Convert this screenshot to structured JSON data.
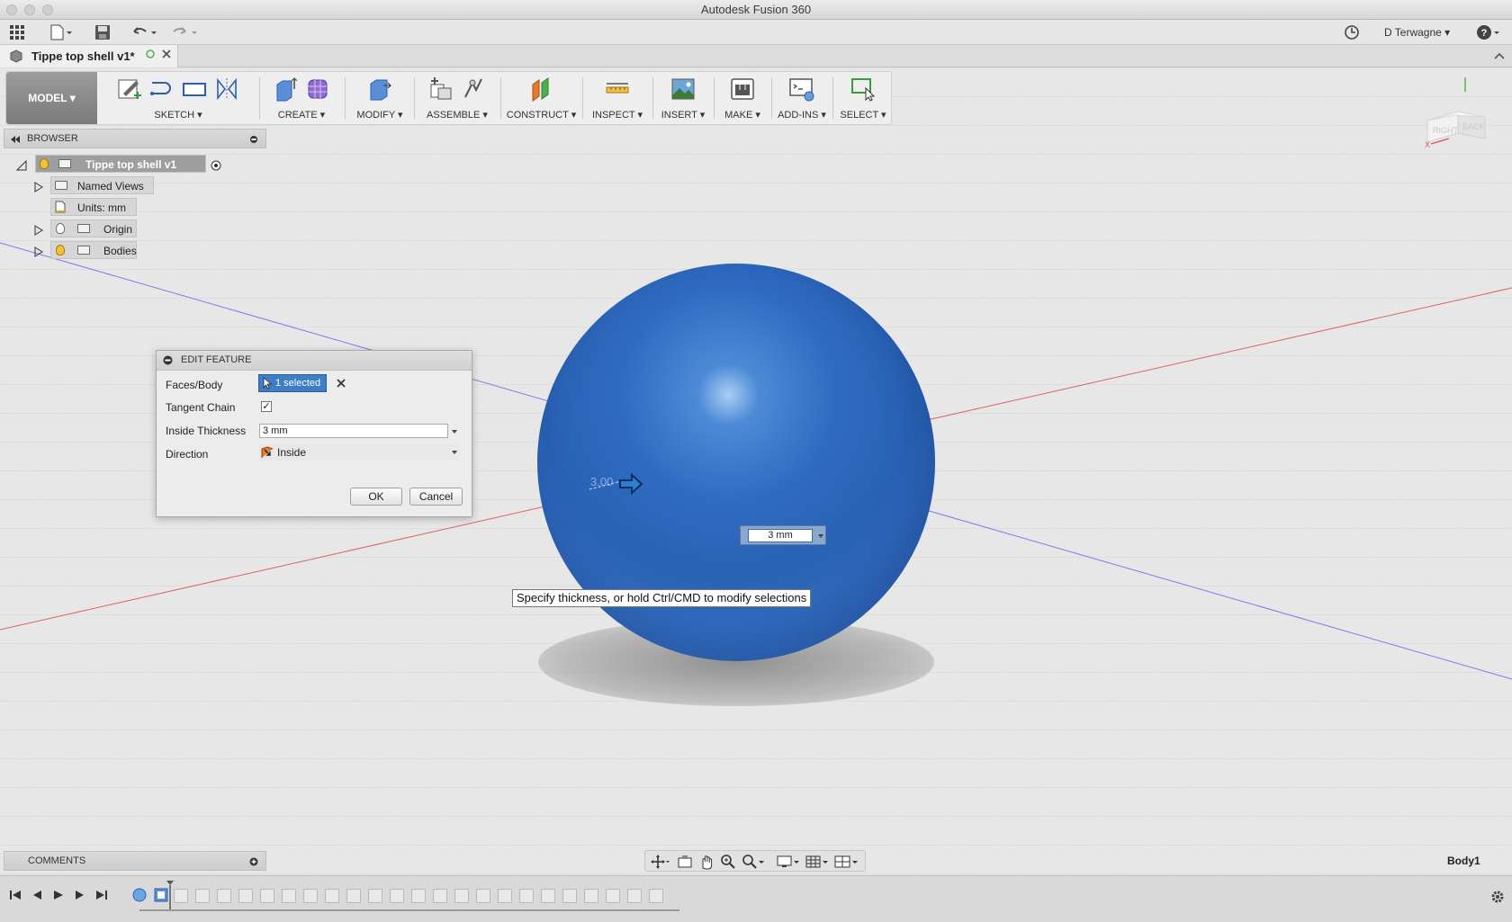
{
  "window": {
    "title": "Autodesk Fusion 360"
  },
  "app_toolbar": {
    "user": "D Terwagne ▾"
  },
  "document_tab": {
    "label": "Tippe top shell v1*"
  },
  "ribbon": {
    "workspace": "MODEL ▾",
    "groups": [
      {
        "label": "SKETCH ▾"
      },
      {
        "label": "CREATE ▾"
      },
      {
        "label": "MODIFY ▾"
      },
      {
        "label": "ASSEMBLE ▾"
      },
      {
        "label": "CONSTRUCT ▾"
      },
      {
        "label": "INSPECT ▾"
      },
      {
        "label": "INSERT ▾"
      },
      {
        "label": "MAKE ▾"
      },
      {
        "label": "ADD-INS ▾"
      },
      {
        "label": "SELECT ▾"
      }
    ]
  },
  "browser": {
    "title": "BROWSER",
    "root": "Tippe top shell v1",
    "items": [
      {
        "label": "Named Views"
      },
      {
        "label": "Units: mm"
      },
      {
        "label": "Origin"
      },
      {
        "label": "Bodies"
      }
    ]
  },
  "dialog": {
    "title": "EDIT FEATURE",
    "faces_label": "Faces/Body",
    "faces_value": "1 selected",
    "tangent_label": "Tangent Chain",
    "tangent_checked": "✓",
    "thickness_label": "Inside Thickness",
    "thickness_value": "3 mm",
    "direction_label": "Direction",
    "direction_value": "Inside",
    "ok": "OK",
    "cancel": "Cancel"
  },
  "viewport": {
    "tooltip": "Specify thickness, or hold Ctrl/CMD to modify selections",
    "inline_value": "3 mm",
    "ghost_dimension": "3.00",
    "body_label": "Body1",
    "viewcube_faces": [
      "RIGHT",
      "BACK"
    ],
    "axis_x_label": "X"
  },
  "comments": {
    "title": "COMMENTS"
  },
  "colors": {
    "sphere": "#2f6bc0",
    "selection": "#3d7ec4",
    "x_axis": "#e05050",
    "y_axis": "#6a6ae0"
  }
}
